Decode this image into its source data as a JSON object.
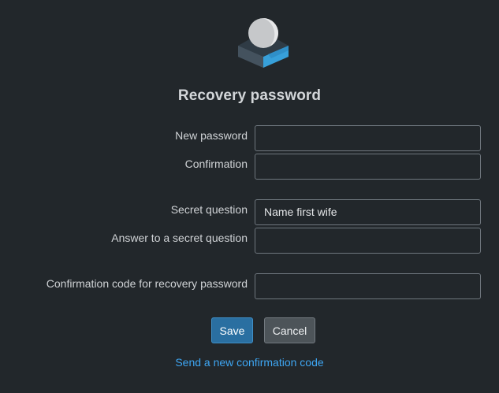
{
  "brand": {
    "logo_icon": "roundcube-logo-icon",
    "colors": {
      "cube_dark": "#3c4a56",
      "cube_blue": "#37a0da",
      "ball": "#c6c8ca"
    }
  },
  "title": "Recovery password",
  "form": {
    "new_password": {
      "label": "New password",
      "value": ""
    },
    "confirmation": {
      "label": "Confirmation",
      "value": ""
    },
    "secret_question": {
      "label": "Secret question",
      "value": "Name first wife"
    },
    "answer": {
      "label": "Answer to a secret question",
      "value": ""
    },
    "confirmation_code": {
      "label": "Confirmation code for recovery password",
      "value": ""
    }
  },
  "buttons": {
    "save": "Save",
    "cancel": "Cancel"
  },
  "resend_link": "Send a new confirmation code",
  "colors": {
    "background": "#22272b",
    "primary_button": "#2a6fa1",
    "secondary_button": "#4d5459",
    "link": "#3ea6f3"
  }
}
